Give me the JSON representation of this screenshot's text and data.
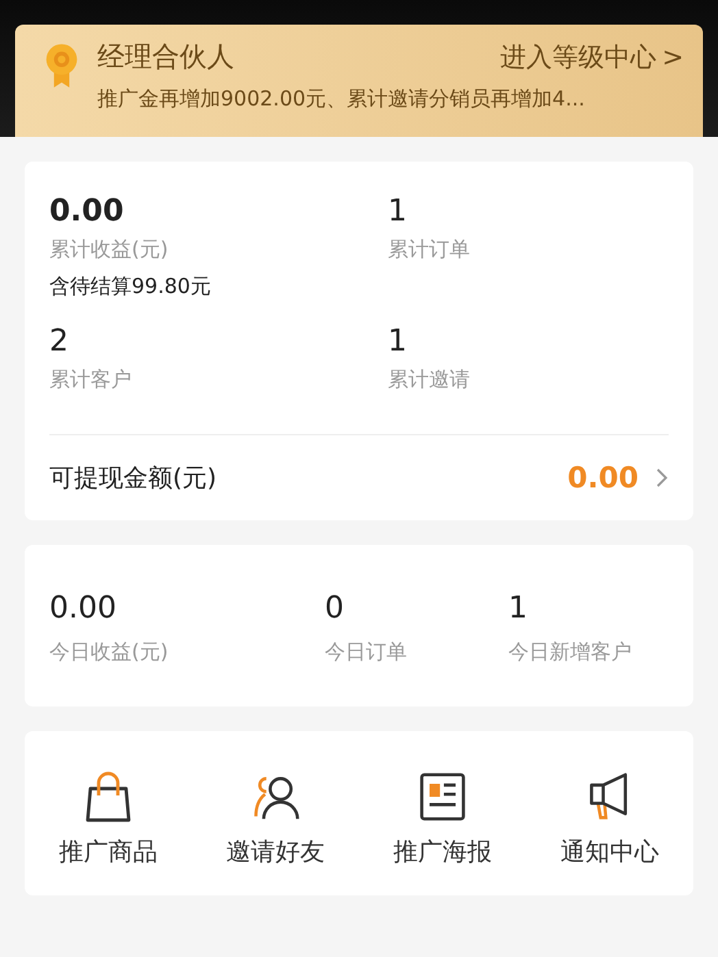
{
  "level_banner": {
    "title": "经理合伙人",
    "link": "进入等级中心",
    "chevron": ">",
    "description": "推广金再增加9002.00元、累计邀请分销员再增加4..."
  },
  "totals": {
    "stats": [
      {
        "value": "0.00",
        "label": "累计收益(元)",
        "note": "含待结算99.80元",
        "emphasis": true
      },
      {
        "value": "1",
        "label": "累计订单",
        "emphasis": false
      },
      {
        "value": "2",
        "label": "累计客户",
        "emphasis": false
      },
      {
        "value": "1",
        "label": "累计邀请",
        "emphasis": false
      }
    ],
    "withdrawable": {
      "label": "可提现金额(元)",
      "amount": "0.00"
    }
  },
  "today": [
    {
      "value": "0.00",
      "label": "今日收益(元)"
    },
    {
      "value": "0",
      "label": "今日订单"
    },
    {
      "value": "1",
      "label": "今日新增客户"
    }
  ],
  "shortcuts": [
    {
      "kind": "bag",
      "label": "推广商品"
    },
    {
      "kind": "people",
      "label": "邀请好友"
    },
    {
      "kind": "poster",
      "label": "推广海报"
    },
    {
      "kind": "megaphone",
      "label": "通知中心"
    }
  ]
}
